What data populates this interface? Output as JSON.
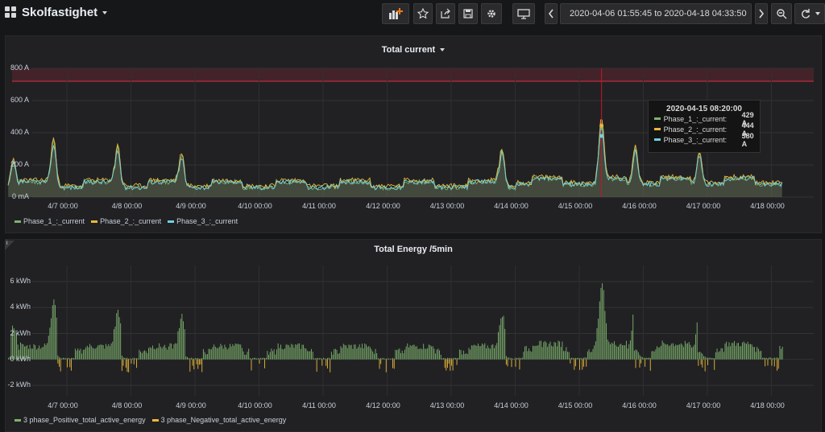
{
  "header": {
    "dashboard_title": "Skolfastighet",
    "time_range": "2020-04-06 01:55:45 to 2020-04-18 04:33:50",
    "icons": [
      "dashboard-grid-icon",
      "add-panel-icon",
      "star-icon",
      "share-icon",
      "save-icon",
      "settings-icon",
      "tv-mode-icon",
      "time-back-icon",
      "clock-icon",
      "time-forward-icon",
      "zoom-out-icon",
      "refresh-icon",
      "refresh-interval-caret-icon"
    ]
  },
  "panel_current": {
    "title": "Total current",
    "y_ticks": [
      "800 A",
      "600 A",
      "400 A",
      "200 A",
      "0 mA"
    ],
    "x_ticks": [
      "4/7 00:00",
      "4/8 00:00",
      "4/9 00:00",
      "4/10 00:00",
      "4/11 00:00",
      "4/12 00:00",
      "4/13 00:00",
      "4/14 00:00",
      "4/15 00:00",
      "4/16 00:00",
      "4/17 00:00",
      "4/18 00:00"
    ],
    "legend": [
      "Phase_1_:_current",
      "Phase_2_:_current",
      "Phase_3_:_current"
    ],
    "threshold_label": "",
    "tooltip": {
      "time": "2020-04-15 08:20:00",
      "rows": [
        {
          "name": "Phase_1_:_current:",
          "value": "429 A"
        },
        {
          "name": "Phase_2_:_current:",
          "value": "444 A"
        },
        {
          "name": "Phase_3_:_current:",
          "value": "380 A"
        }
      ]
    }
  },
  "panel_energy": {
    "title": "Total Energy /5min",
    "y_ticks": [
      "6 kWh",
      "4 kWh",
      "2 kWh",
      "0 kWh",
      "-2 kWh"
    ],
    "x_ticks": [
      "4/7 00:00",
      "4/8 00:00",
      "4/9 00:00",
      "4/10 00:00",
      "4/11 00:00",
      "4/12 00:00",
      "4/13 00:00",
      "4/14 00:00",
      "4/15 00:00",
      "4/16 00:00",
      "4/17 00:00",
      "4/18 00:00"
    ],
    "legend": [
      "3 phase_Positive_total_active_energy",
      "3 phase_Negative_total_active_energy"
    ]
  },
  "colors": {
    "phase1": "#7eb26d",
    "phase2": "#eab839",
    "phase3": "#6ed0e0",
    "threshold": "#e02f44",
    "positive": "#7eb26d",
    "negative": "#eab839"
  },
  "chart_data": [
    {
      "type": "line",
      "title": "Total current",
      "ylim": [
        0,
        800
      ],
      "y_unit": "A",
      "threshold": {
        "value": 720,
        "fill_above": true
      },
      "x": [
        "4/7",
        "4/8",
        "4/9",
        "4/10",
        "4/11",
        "4/12",
        "4/13",
        "4/14",
        "4/15",
        "4/16",
        "4/17",
        "4/18"
      ],
      "series": [
        {
          "name": "Phase_1_:_current",
          "peaks": [
            {
              "x": "4/6 04:00",
              "y": 230
            },
            {
              "x": "4/6 19:00",
              "y": 360
            },
            {
              "x": "4/7 19:00",
              "y": 320
            },
            {
              "x": "4/8 19:00",
              "y": 270
            },
            {
              "x": "4/13 19:00",
              "y": 300
            },
            {
              "x": "4/15 08:20",
              "y": 429
            },
            {
              "x": "4/15 21:00",
              "y": 300
            },
            {
              "x": "4/16 21:00",
              "y": 260
            }
          ],
          "baseline": 60
        },
        {
          "name": "Phase_2_:_current",
          "baseline": 70
        },
        {
          "name": "Phase_3_:_current",
          "baseline": 60
        }
      ],
      "hover": {
        "x": "2020-04-15 08:20:00",
        "values": {
          "Phase_1_:_current": 429,
          "Phase_2_:_current": 444,
          "Phase_3_:_current": 380
        }
      }
    },
    {
      "type": "bar",
      "title": "Total Energy /5min",
      "ylim": [
        -2,
        6
      ],
      "y_unit": "kWh",
      "x": [
        "4/7",
        "4/8",
        "4/9",
        "4/10",
        "4/11",
        "4/12",
        "4/13",
        "4/14",
        "4/15",
        "4/16",
        "4/17",
        "4/18"
      ],
      "series": [
        {
          "name": "3 phase_Positive_total_active_energy",
          "baseline": 0.6,
          "peaks": [
            {
              "x": "4/6 04:00",
              "y": 2.6
            },
            {
              "x": "4/6 19:00",
              "y": 4.8
            },
            {
              "x": "4/7 19:00",
              "y": 3.8
            },
            {
              "x": "4/8 19:00",
              "y": 3.3
            },
            {
              "x": "4/13 19:00",
              "y": 3.5
            },
            {
              "x": "4/15 08:20",
              "y": 5.4
            },
            {
              "x": "4/15 21:00",
              "y": 4.9
            },
            {
              "x": "4/16 21:00",
              "y": 3.8
            }
          ]
        },
        {
          "name": "3 phase_Negative_total_active_energy",
          "min": -1.0
        }
      ]
    }
  ]
}
